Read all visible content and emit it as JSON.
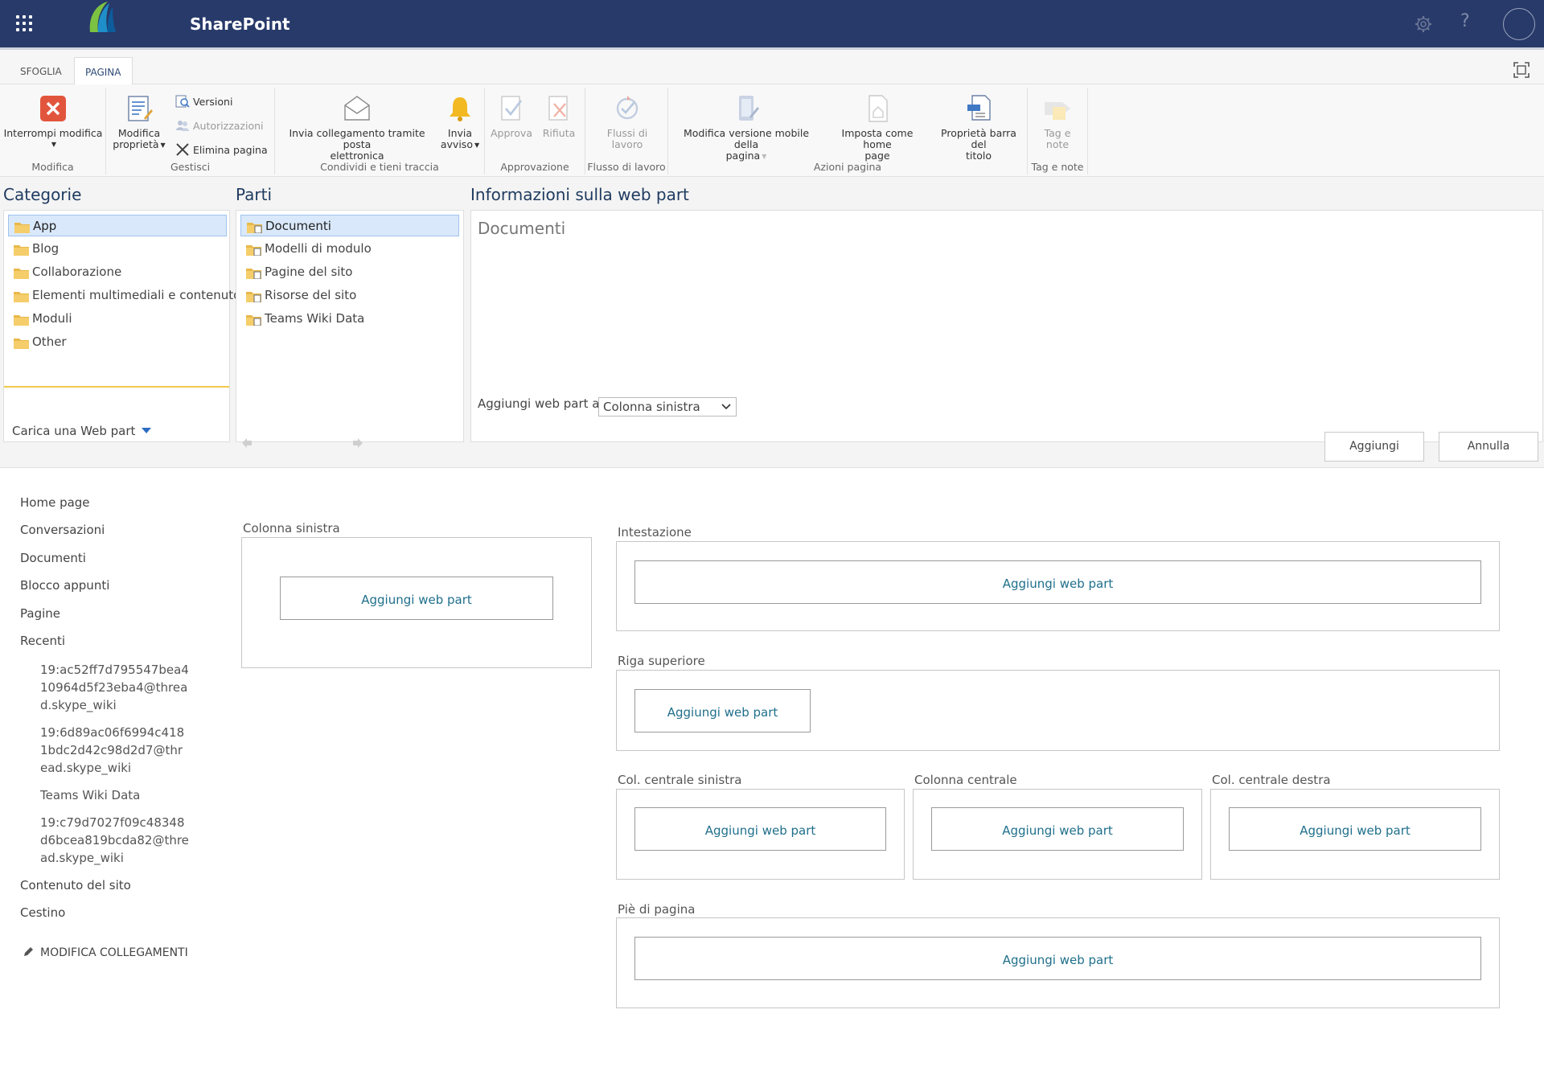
{
  "suite": {
    "brand": "SharePoint",
    "help_glyph": "?",
    "icons": [
      "waffle-icon",
      "gear-icon",
      "help-icon",
      "avatar"
    ]
  },
  "ribbon": {
    "tabs": [
      "SFOGLIA",
      "PAGINA"
    ],
    "active_tab": "PAGINA",
    "groups": {
      "modifica": {
        "label": "Modifica",
        "stop_edit": "Interrompi modifica"
      },
      "gestisci": {
        "label": "Gestisci",
        "edit_props_1": "Modifica",
        "edit_props_2": "proprietà",
        "versions": "Versioni",
        "permissions": "Autorizzazioni",
        "delete_page": "Elimina pagina"
      },
      "condividi": {
        "label": "Condividi e tieni traccia",
        "email_link_1": "Invia collegamento tramite posta",
        "email_link_2": "elettronica",
        "alert_1": "Invia",
        "alert_2": "avviso"
      },
      "approvazione": {
        "label": "Approvazione",
        "approve": "Approva",
        "reject": "Rifiuta"
      },
      "flusso": {
        "label": "Flusso di lavoro",
        "workflows_1": "Flussi di",
        "workflows_2": "lavoro"
      },
      "azioni": {
        "label": "Azioni pagina",
        "mobile_1": "Modifica versione mobile della",
        "mobile_2": "pagina",
        "homepage_1": "Imposta come home",
        "homepage_2": "page",
        "title_bar_1": "Proprietà barra del",
        "title_bar_2": "titolo"
      },
      "tag": {
        "label": "Tag e note",
        "tags_1": "Tag e",
        "tags_2": "note"
      }
    }
  },
  "adder": {
    "categories_title": "Categorie",
    "categories": [
      "App",
      "Blog",
      "Collaborazione",
      "Elementi multimediali e contenuto",
      "Moduli",
      "Other"
    ],
    "selected_category": "App",
    "upload_label": "Carica una Web part",
    "parts_title": "Parti",
    "parts": [
      "Documenti",
      "Modelli di modulo",
      "Pagine del sito",
      "Risorse del sito",
      "Teams Wiki Data"
    ],
    "selected_part": "Documenti",
    "info_title": "Informazioni sulla web part",
    "info_part_name": "Documenti",
    "add_to_label": "Aggiungi web part a:",
    "add_to_value": "Colonna sinistra",
    "add_button": "Aggiungi",
    "cancel_button": "Annulla"
  },
  "quick_launch": {
    "items": [
      "Home page",
      "Conversazioni",
      "Documenti",
      "Blocco appunti",
      "Pagine",
      "Recenti"
    ],
    "recent": [
      "19:ac52ff7d795547bea410964d5f23eba4@thread.skype_wiki",
      "19:6d89ac06f6994c4181bdc2d42c98d2d7@thread.skype_wiki",
      "Teams Wiki Data",
      "19:c79d7027f09c48348d6bcea819bcda82@thread.skype_wiki"
    ],
    "bottom_items": [
      "Contenuto del sito",
      "Cestino"
    ],
    "edit_links": "MODIFICA COLLEGAMENTI"
  },
  "zones": {
    "add_label": "Aggiungi web part",
    "left": "Colonna sinistra",
    "header": "Intestazione",
    "top_row": "Riga superiore",
    "center_left": "Col. centrale sinistra",
    "center": "Colonna centrale",
    "center_right": "Col. centrale destra",
    "footer": "Piè di pagina"
  },
  "colors": {
    "suite_bar": "#273a6a",
    "link": "#1f6f8b",
    "selection": "#d9e9fb",
    "stop_edit_red": "#e2553d"
  }
}
